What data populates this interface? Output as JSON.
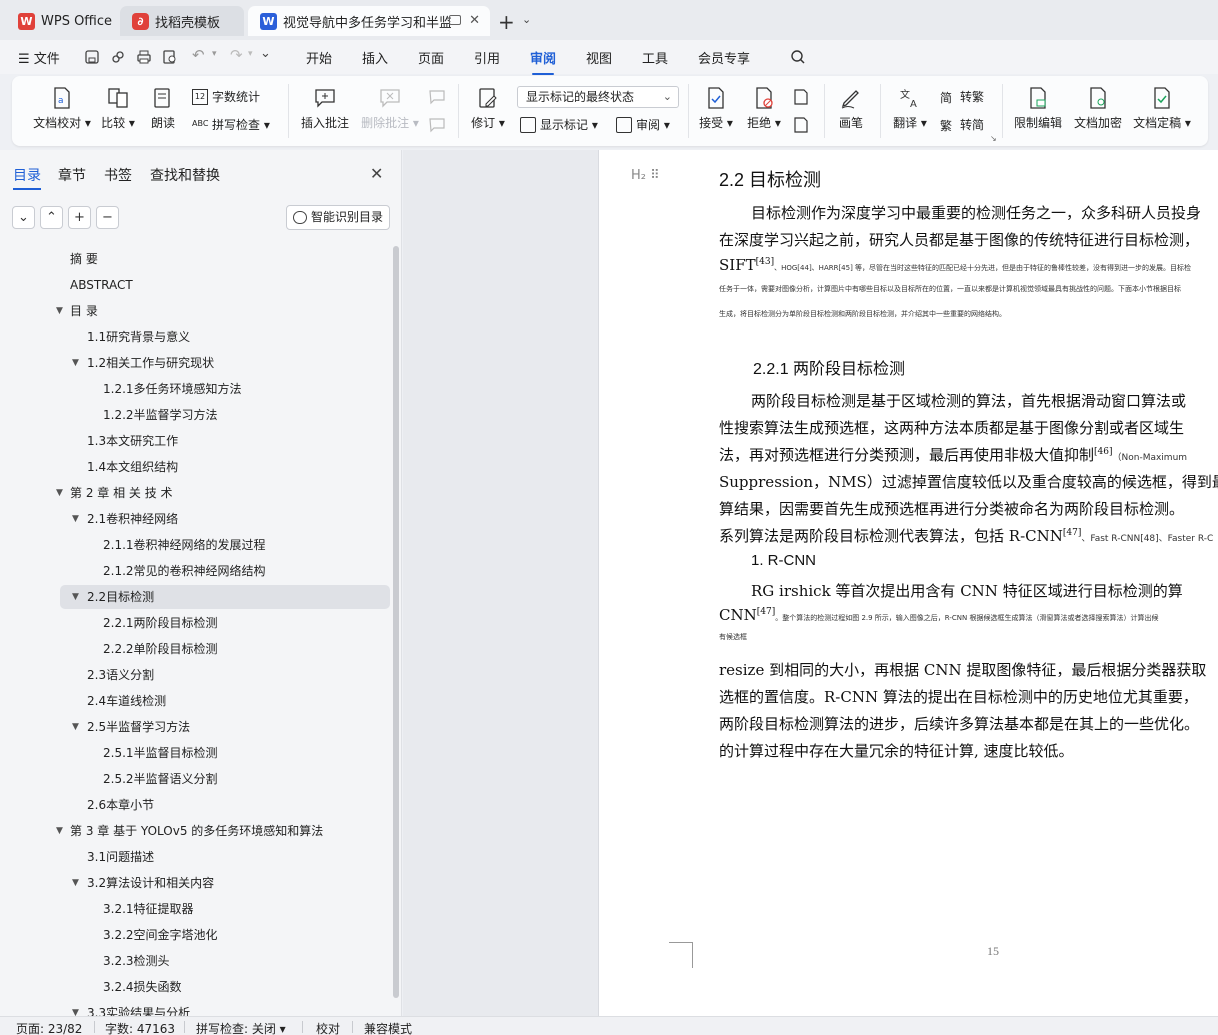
{
  "tabs": [
    {
      "label": "WPS Office",
      "icon": "wps-logo-icon"
    },
    {
      "label": "找稻壳模板",
      "icon": "docer-icon"
    },
    {
      "label": "视觉导航中多任务学习和半监督",
      "icon": "word-doc-icon"
    }
  ],
  "menubar": {
    "file": "文件",
    "items": [
      "开始",
      "插入",
      "页面",
      "引用",
      "审阅",
      "视图",
      "工具",
      "会员专享"
    ],
    "active": "审阅"
  },
  "ribbon": {
    "doc_proofread": "文档校对",
    "compare": "比较",
    "read_aloud": "朗读",
    "word_count": "字数统计",
    "spell_check": "拼写检查",
    "insert_comment": "插入批注",
    "delete_comment": "删除批注",
    "revise": "修订",
    "markup_state": "显示标记的最终状态",
    "show_markup": "显示标记",
    "review": "审阅",
    "accept": "接受",
    "reject": "拒绝",
    "pen": "画笔",
    "translate": "翻译",
    "to_traditional": "转繁",
    "to_simplified": "转简",
    "restrict_edit": "限制编辑",
    "encrypt": "文档加密",
    "finalize": "文档定稿"
  },
  "nav": {
    "tabs": [
      "目录",
      "章节",
      "书签",
      "查找和替换"
    ],
    "smart_toc": "智能识别目录",
    "toc": [
      {
        "label": "摘  要",
        "level": 1,
        "arrow": ""
      },
      {
        "label": "ABSTRACT",
        "level": 1,
        "arrow": ""
      },
      {
        "label": "目  录",
        "level": 1,
        "arrow": "▼"
      },
      {
        "label": "1.1研究背景与意义",
        "level": 2,
        "arrow": ""
      },
      {
        "label": "1.2相关工作与研究现状",
        "level": 2,
        "arrow": "▼"
      },
      {
        "label": "1.2.1多任务环境感知方法",
        "level": 3,
        "arrow": ""
      },
      {
        "label": "1.2.2半监督学习方法",
        "level": 3,
        "arrow": ""
      },
      {
        "label": "1.3本文研究工作",
        "level": 2,
        "arrow": ""
      },
      {
        "label": "1.4本文组织结构",
        "level": 2,
        "arrow": ""
      },
      {
        "label": "第 2 章  相 关 技 术",
        "level": 1,
        "arrow": "▼"
      },
      {
        "label": "2.1卷积神经网络",
        "level": 2,
        "arrow": "▼"
      },
      {
        "label": "2.1.1卷积神经网络的发展过程",
        "level": 3,
        "arrow": ""
      },
      {
        "label": "2.1.2常见的卷积神经网络结构",
        "level": 3,
        "arrow": ""
      },
      {
        "label": "2.2目标检测",
        "level": 2,
        "arrow": "▼",
        "selected": true
      },
      {
        "label": "2.2.1两阶段目标检测",
        "level": 3,
        "arrow": ""
      },
      {
        "label": "2.2.2单阶段目标检测",
        "level": 3,
        "arrow": ""
      },
      {
        "label": "2.3语义分割",
        "level": 2,
        "arrow": ""
      },
      {
        "label": "2.4车道线检测",
        "level": 2,
        "arrow": ""
      },
      {
        "label": "2.5半监督学习方法",
        "level": 2,
        "arrow": "▼"
      },
      {
        "label": "2.5.1半监督目标检测",
        "level": 3,
        "arrow": ""
      },
      {
        "label": "2.5.2半监督语义分割",
        "level": 3,
        "arrow": ""
      },
      {
        "label": "2.6本章小节",
        "level": 2,
        "arrow": ""
      },
      {
        "label": "第 3 章  基于 YOLOv5 的多任务环境感知和算法",
        "level": 1,
        "arrow": "▼"
      },
      {
        "label": "3.1问题描述",
        "level": 2,
        "arrow": ""
      },
      {
        "label": "3.2算法设计和相关内容",
        "level": 2,
        "arrow": "▼"
      },
      {
        "label": "3.2.1特征提取器",
        "level": 3,
        "arrow": ""
      },
      {
        "label": "3.2.2空间金字塔池化",
        "level": 3,
        "arrow": ""
      },
      {
        "label": "3.2.3检测头",
        "level": 3,
        "arrow": ""
      },
      {
        "label": "3.2.4损失函数",
        "level": 3,
        "arrow": ""
      },
      {
        "label": "3.3实验结果与分析",
        "level": 2,
        "arrow": "▼"
      }
    ]
  },
  "doc": {
    "h2": "2.2   目标检测",
    "p1": [
      "目标检测作为深度学习中最重要的检测任务之一，众多科研人员投身",
      "在深度学习兴起之前，研究人员都是基于图像的传统特征进行目标检测，"
    ],
    "p1_sift": "SIFT",
    "p1_sift_ref": "[43]",
    "p1_small": "、HOG[44]、HARR[45] 等，尽管在当时这些特征的匹配已经十分先进，但是由于特征的鲁棒性较差，没有得到进一步的发展。目标检",
    "p1_tiny2": "任务于一体，需要对图像分析，计算图片中有哪些目标以及目标所在的位置，一直以来都是计算机视觉领域最具有挑战性的问题。下面本小节根据目标",
    "p1_tiny3": "生成，将目标检测分为单阶段目标检测和两阶段目标检测，并介绍其中一些重要的网络结构。",
    "h3": "2.2.1    两阶段目标检测",
    "p2": [
      "两阶段目标检测是基于区域检测的算法，首先根据滑动窗口算法或",
      "性搜索算法生成预选框，这两种方法本质都是基于图像分割或者区域生"
    ],
    "p2_l3": "法，再对预选框进行分类预测，最后再使用非极大值抑制",
    "p2_l3_ref": "[46]",
    "p2_l3_small": "（Non-Maximum",
    "p2_l4": "Suppression，NMS）过滤掉置信度较低以及重合度较高的候选框，得到最",
    "p2_l5": "算结果，因需要首先生成预选框再进行分类被命名为两阶段目标检测。",
    "p2_l6": "系列算法是两阶段目标检测代表算法，包括 R-CNN",
    "p2_l6_ref": "[47]",
    "p2_l6_small": "、Fast R-CNN[48]、Faster R-C",
    "sub1": "1.  R-CNN",
    "p3_l1": "RG  irshick 等首次提出用含有  CNN 特征区域进行目标检测的算",
    "p3_l2": "CNN",
    "p3_l2_ref": "[47]",
    "p3_l2_small": "。整个算法的检测过程如图 2.9 所示，输入图像之后，R-CNN 根据候选框生成算法（滑窗算法或者选择搜索算法）计算出候",
    "p3_l3_small": "有候选框",
    "p4": [
      "resize 到相同的大小，再根据  CNN 提取图像特征，最后根据分类器获取",
      "选框的置信度。R-CNN 算法的提出在目标检测中的历史地位尤其重要，",
      "两阶段目标检测算法的进步，后续许多算法基本都是在其上的一些优化。",
      "的计算过程中存在大量冗余的特征计算, 速度比较低。"
    ],
    "page_number": "15"
  },
  "status": {
    "page": "页面: 23/82",
    "words": "字数: 47163",
    "spell": "拼写检查: 关闭",
    "proof": "校对",
    "compat": "兼容模式"
  },
  "colors": {
    "accent": "#1f5fd6",
    "wps_red": "#e0413a",
    "word_blue": "#2b5fd9"
  }
}
